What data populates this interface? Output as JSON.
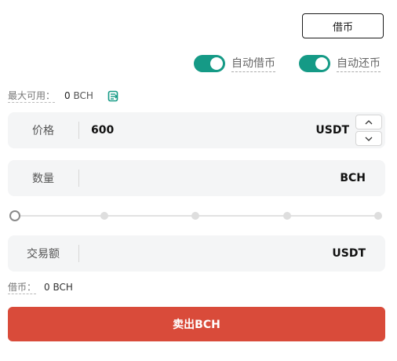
{
  "borrow_button": "借币",
  "toggles": {
    "auto_borrow": {
      "label": "自动借币",
      "on": true
    },
    "auto_repay": {
      "label": "自动还币",
      "on": true
    }
  },
  "max_available": {
    "label": "最大可用：",
    "amount": "0",
    "unit": "BCH"
  },
  "price": {
    "label": "价格",
    "value": "600",
    "unit": "USDT"
  },
  "quantity": {
    "label": "数量",
    "value": "",
    "unit": "BCH"
  },
  "slider": {
    "percent": 0,
    "steps": 5
  },
  "total": {
    "label": "交易额",
    "value": "",
    "unit": "USDT"
  },
  "borrowed": {
    "label": "借币：",
    "amount": "0",
    "unit": "BCH"
  },
  "sell_button": "卖出BCH",
  "colors": {
    "toggle_on": "#159a86",
    "sell": "#d94b3a"
  },
  "icons": {
    "transfer": "transfer-icon",
    "up": "chevron-up-icon",
    "down": "chevron-down-icon"
  }
}
